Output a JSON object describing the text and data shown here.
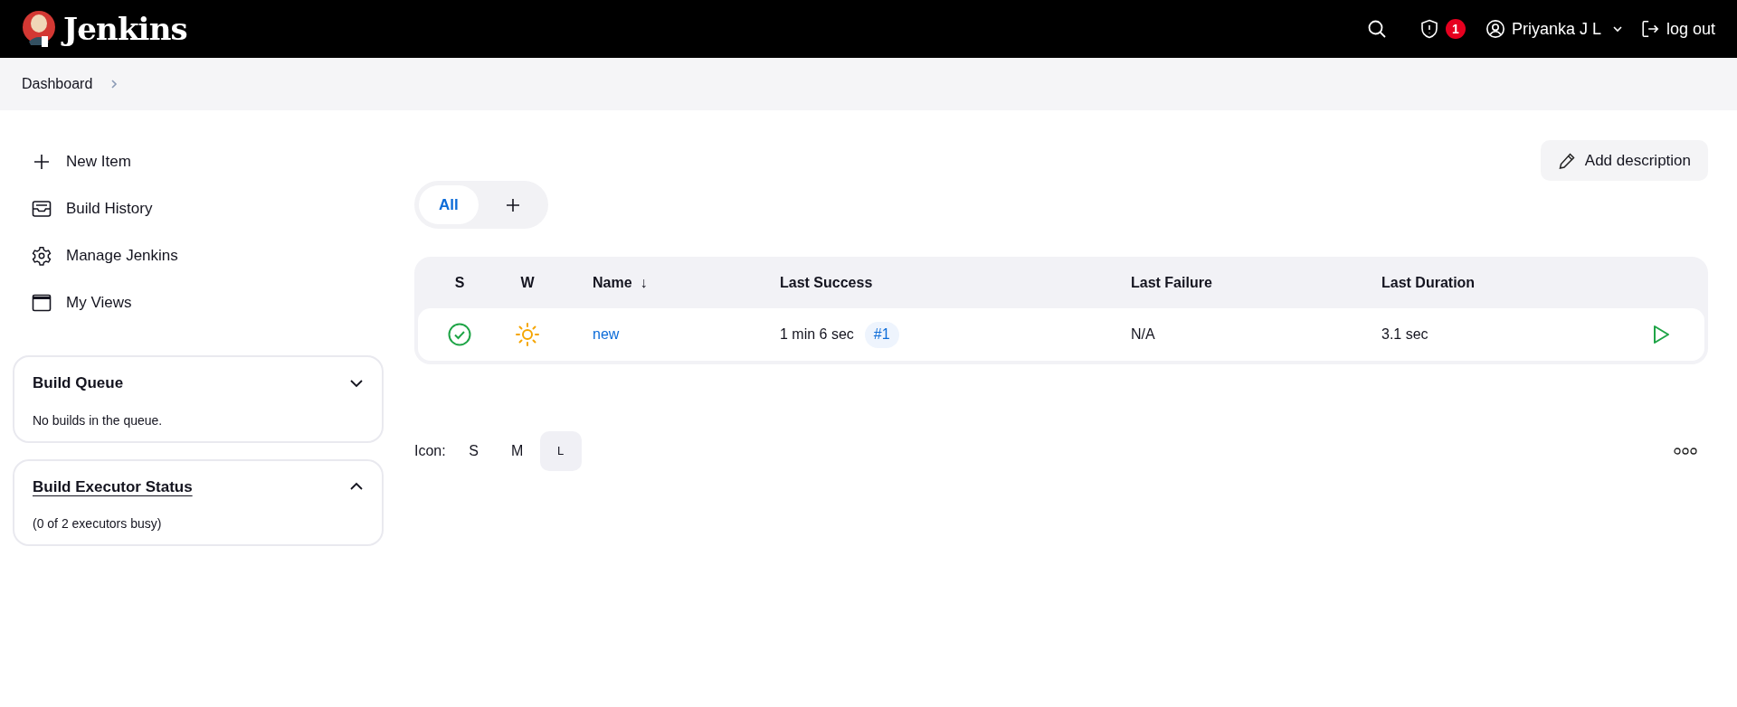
{
  "header": {
    "brand": "Jenkins",
    "alert_count": "1",
    "user": "Priyanka J L",
    "logout": "log out"
  },
  "breadcrumb": [
    {
      "label": "Dashboard"
    }
  ],
  "sidebar": {
    "tasks": [
      {
        "label": "New Item",
        "kind": "plus"
      },
      {
        "label": "Build History",
        "kind": "inbox"
      },
      {
        "label": "Manage Jenkins",
        "kind": "gear"
      },
      {
        "label": "My Views",
        "kind": "window"
      }
    ],
    "panels": [
      {
        "title": "Build Queue",
        "link": false,
        "expanded": false,
        "text": "No builds in the queue."
      },
      {
        "title": "Build Executor Status",
        "link": true,
        "expanded": true,
        "text": "(0 of 2 executors busy)"
      }
    ]
  },
  "add_description": "Add description",
  "view_tabs": [
    {
      "label": "All",
      "selected": true
    }
  ],
  "table": {
    "columns": [
      {
        "label": "S"
      },
      {
        "label": "W"
      },
      {
        "label": "Name",
        "sort": "↓"
      },
      {
        "label": "Last Success"
      },
      {
        "label": "Last Failure"
      },
      {
        "label": "Last Duration"
      }
    ],
    "rows": [
      {
        "cells": [
          {
            "kind": "success"
          },
          {
            "kind": "sunny"
          },
          {
            "kind": "link",
            "text": "new"
          },
          {
            "kind": "build",
            "text": "1 min 6 sec",
            "build": "#1"
          },
          {
            "kind": "text",
            "text": "N/A"
          },
          {
            "kind": "text",
            "text": "3.1 sec"
          }
        ]
      }
    ]
  },
  "icon_size": {
    "label": "Icon:",
    "options": [
      {
        "label": "S",
        "selected": false
      },
      {
        "label": "M",
        "selected": false
      },
      {
        "label": "L",
        "selected": true
      }
    ]
  }
}
